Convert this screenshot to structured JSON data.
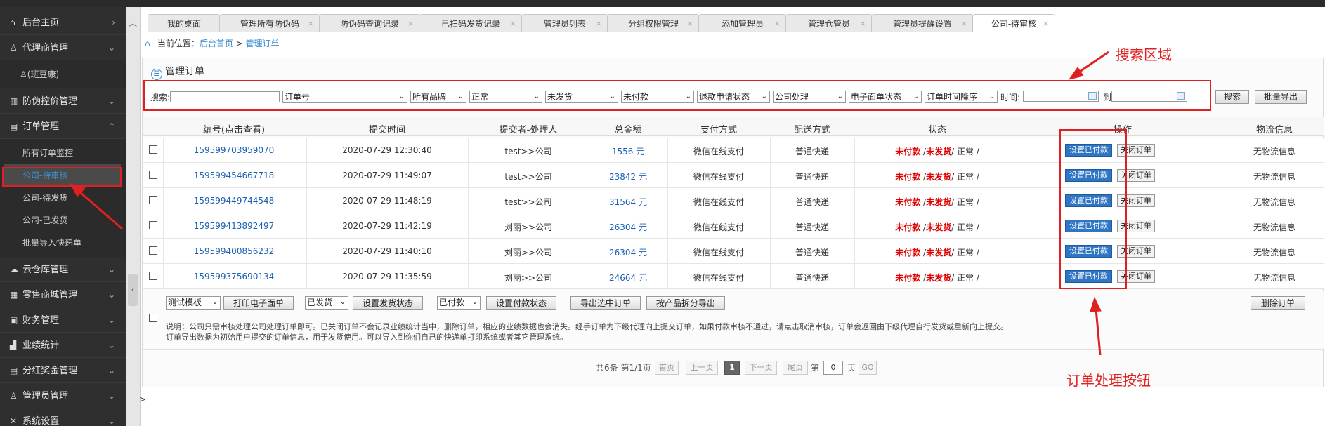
{
  "sidebar": {
    "items": [
      {
        "icon": "home-icon",
        "glyph": "⌂",
        "label": "后台主页",
        "chevron": "›"
      },
      {
        "icon": "user-icon",
        "glyph": "♙",
        "label": "代理商管理",
        "chevron": "⌄"
      },
      {
        "icon": "user-small-icon",
        "glyph": "♙",
        "label": "(班豆康)"
      },
      {
        "icon": "barcode-icon",
        "glyph": "▥",
        "label": "防伪控价管理",
        "chevron": "⌄"
      },
      {
        "icon": "doc-icon",
        "glyph": "▤",
        "label": "订单管理",
        "chevron": "⌃"
      },
      {
        "label": "所有订单监控"
      },
      {
        "label": "公司-待审核"
      },
      {
        "label": "公司-待发货"
      },
      {
        "label": "公司-已发货"
      },
      {
        "label": "批量导入快递单"
      },
      {
        "icon": "cloud-icon",
        "glyph": "☁",
        "label": "云仓库管理",
        "chevron": "⌄"
      },
      {
        "icon": "shop-icon",
        "glyph": "▦",
        "label": "零售商城管理",
        "chevron": "⌄"
      },
      {
        "icon": "finance-icon",
        "glyph": "▣",
        "label": "财务管理",
        "chevron": "⌄"
      },
      {
        "icon": "chart-icon",
        "glyph": "▟",
        "label": "业绩统计",
        "chevron": "⌄"
      },
      {
        "icon": "bonus-icon",
        "glyph": "▤",
        "label": "分红奖金管理",
        "chevron": "⌄"
      },
      {
        "icon": "admin-icon",
        "glyph": "♙",
        "label": "管理员管理",
        "chevron": "⌄"
      },
      {
        "icon": "settings-icon",
        "glyph": "✕",
        "label": "系统设置",
        "chevron": "⌄"
      }
    ]
  },
  "tabs": [
    {
      "label": "我的桌面",
      "close": ""
    },
    {
      "label": "管理所有防伪码",
      "close": "×"
    },
    {
      "label": "防伪码查询记录",
      "close": "×"
    },
    {
      "label": "已扫码发货记录",
      "close": "×"
    },
    {
      "label": "管理员列表",
      "close": "×"
    },
    {
      "label": "分组权限管理",
      "close": "×"
    },
    {
      "label": "添加管理员",
      "close": "×"
    },
    {
      "label": "管理仓管员",
      "close": "×"
    },
    {
      "label": "管理员提醒设置",
      "close": "×"
    },
    {
      "label": "公司-待审核",
      "close": "×"
    }
  ],
  "breadcrumb": {
    "prefix": "当前位置：",
    "home": "后台首页",
    "sep": " > ",
    "current": "管理订单"
  },
  "panel_title": "管理订单",
  "search": {
    "label": "搜索:",
    "selects": [
      "订单号",
      "所有品牌",
      "正常",
      "未发货",
      "未付款",
      "退款申请状态",
      "公司处理",
      "电子面单状态",
      "订单时间降序"
    ],
    "time_label": "时间:",
    "to_label": "到",
    "search_button": "搜索",
    "export_button": "批量导出"
  },
  "table": {
    "headers": [
      "编号(点击查看)",
      "提交时间",
      "提交者-处理人",
      "总金额",
      "支付方式",
      "配送方式",
      "状态",
      "操作",
      "物流信息"
    ],
    "rows": [
      {
        "id": "159599703959070",
        "time": "2020-07-29 12:30:40",
        "submitter": "test>>公司",
        "amount": "1556 元",
        "pay": "微信在线支付",
        "ship": "普通快递",
        "s1": "未付款",
        "s2": "未发货",
        "s3": "正常",
        "logistics": "无物流信息"
      },
      {
        "id": "159599454667718",
        "time": "2020-07-29 11:49:07",
        "submitter": "test>>公司",
        "amount": "23842 元",
        "pay": "微信在线支付",
        "ship": "普通快递",
        "s1": "未付款",
        "s2": "未发货",
        "s3": "正常",
        "logistics": "无物流信息"
      },
      {
        "id": "159599449744548",
        "time": "2020-07-29 11:48:19",
        "submitter": "test>>公司",
        "amount": "31564 元",
        "pay": "微信在线支付",
        "ship": "普通快递",
        "s1": "未付款",
        "s2": "未发货",
        "s3": "正常",
        "logistics": "无物流信息"
      },
      {
        "id": "159599413892497",
        "time": "2020-07-29 11:42:19",
        "submitter": "刘丽>>公司",
        "amount": "26304 元",
        "pay": "微信在线支付",
        "ship": "普通快递",
        "s1": "未付款",
        "s2": "未发货",
        "s3": "正常",
        "logistics": "无物流信息"
      },
      {
        "id": "159599400856232",
        "time": "2020-07-29 11:40:10",
        "submitter": "刘丽>>公司",
        "amount": "26304 元",
        "pay": "微信在线支付",
        "ship": "普通快递",
        "s1": "未付款",
        "s2": "未发货",
        "s3": "正常",
        "logistics": "无物流信息"
      },
      {
        "id": "159599375690134",
        "time": "2020-07-29 11:35:59",
        "submitter": "刘丽>>公司",
        "amount": "24664 元",
        "pay": "微信在线支付",
        "ship": "普通快递",
        "s1": "未付款",
        "s2": "未发货",
        "s3": "正常",
        "logistics": "无物流信息"
      }
    ],
    "set_paid_label": "设置已付款",
    "close_order_label": "关闭订单"
  },
  "actions": {
    "template_select": "测试模板",
    "print_button": "打印电子面单",
    "ship_select": "已发货",
    "set_ship_button": "设置发货状态",
    "pay_select": "已付款",
    "set_pay_button": "设置付款状态",
    "export_selected_button": "导出选中订单",
    "split_export_button": "按产品拆分导出",
    "delete_button": "删除订单"
  },
  "note": {
    "line1": "说明：公司只需审核处理公司处理订单即可。已关闭订单不会记录业绩统计当中，删除订单，相应的业绩数据也会消失。经手订单为下级代理向上提交订单，如果付款审核不通过，请点击取消审核，订单会返回由下级代理自行发货或重新向上提交。",
    "line2": "订单导出数据为初始用户提交的订单信息，用于发货使用。可以导入到你们自己的快递单打印系统或者其它管理系统。"
  },
  "pager": {
    "summary": "共6条 第1/1页",
    "first": "首页",
    "prev": "上一页",
    "current": "1",
    "next": "下一页",
    "last": "尾页",
    "goto_prefix": "第",
    "goto_value": "0",
    "goto_suffix": "页",
    "go_button": "GO"
  },
  "annotations": {
    "search_area": "搜索区域",
    "order_button": "订单处理按钮",
    "color": "#e02020"
  },
  "footer_char": ">"
}
